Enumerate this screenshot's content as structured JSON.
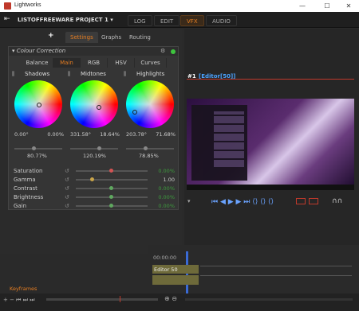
{
  "window": {
    "title": "Lightworks",
    "minimize": "—",
    "maximize": "☐",
    "close": "✕"
  },
  "header": {
    "project": "LISTOFFREEWARE PROJECT 1 ▾",
    "tabs": [
      "LOG",
      "EDIT",
      "VFX",
      "AUDIO"
    ],
    "active_tab": "VFX"
  },
  "panel": {
    "add": "+",
    "tabs": [
      "Settings",
      "Graphs",
      "Routing"
    ],
    "active_tab": "Settings"
  },
  "cc": {
    "title": "Colour Correction",
    "subtabs": [
      "Balance",
      "Main",
      "RGB",
      "HSV",
      "Curves"
    ],
    "active_subtab": "Main",
    "wheels": [
      {
        "name": "Shadows",
        "hue": "0.00°",
        "sat": "0.00%",
        "level": "80.77%"
      },
      {
        "name": "Midtones",
        "hue": "331.58°",
        "sat": "18.64%",
        "level": "120.19%"
      },
      {
        "name": "Highlights",
        "hue": "203.78°",
        "sat": "71.68%",
        "level": "78.85%"
      }
    ],
    "rows": [
      {
        "label": "Saturation",
        "value": "0.00%"
      },
      {
        "label": "Gamma",
        "value": "1.00"
      },
      {
        "label": "Contrast",
        "value": "0.00%"
      },
      {
        "label": "Brightness",
        "value": "0.00%"
      },
      {
        "label": "Gain",
        "value": "0.00%"
      }
    ]
  },
  "viewer": {
    "number": "#1",
    "name": "[Editor[50]]"
  },
  "timeline": {
    "timecode": "00:00:00",
    "clip": "Editor 50"
  },
  "bottom": {
    "keyframes": "Keyframes"
  },
  "colors": {
    "accent": "#e67e22",
    "link": "#4aa3ff",
    "green": "#3d9a3d"
  }
}
